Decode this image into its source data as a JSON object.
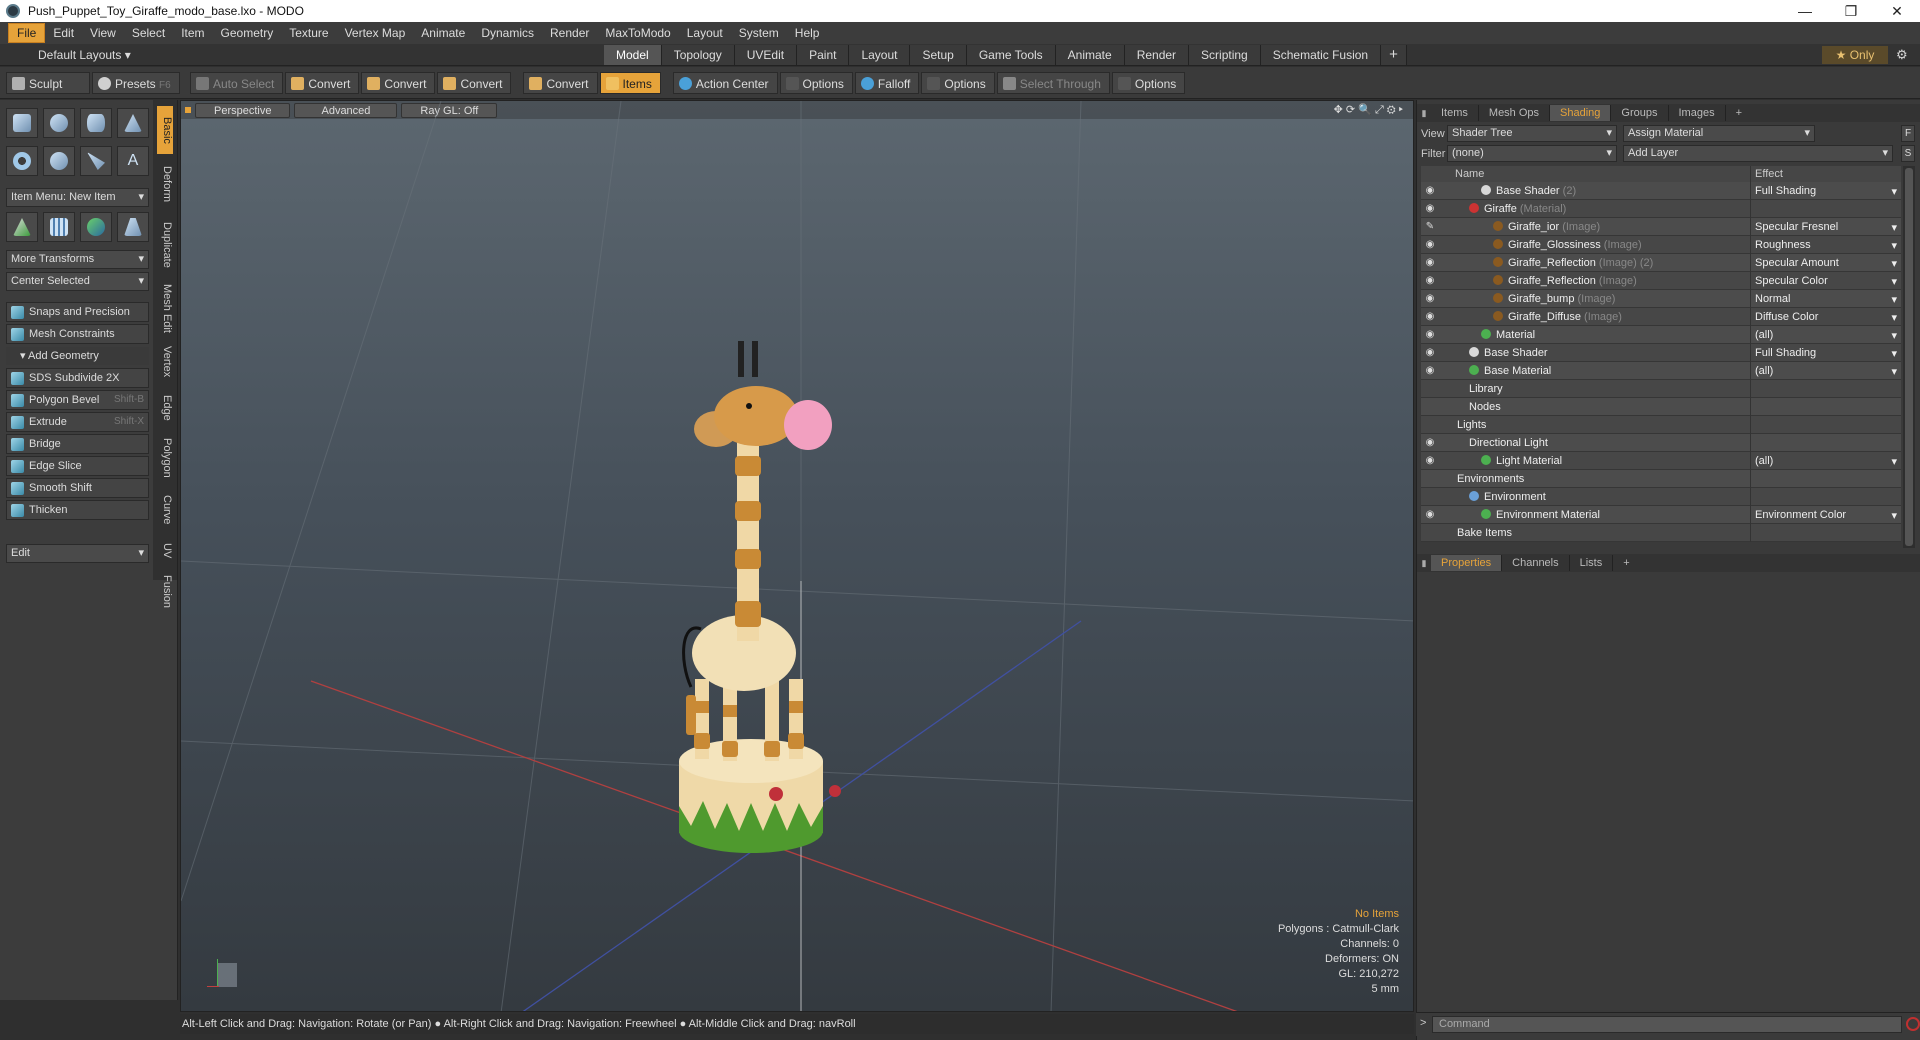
{
  "window": {
    "title": "Push_Puppet_Toy_Giraffe_modo_base.lxo - MODO",
    "minimize": "—",
    "restore": "❐",
    "close": "✕"
  },
  "menu": [
    "File",
    "Edit",
    "View",
    "Select",
    "Item",
    "Geometry",
    "Texture",
    "Vertex Map",
    "Animate",
    "Dynamics",
    "Render",
    "MaxToModo",
    "Layout",
    "System",
    "Help"
  ],
  "layouts": {
    "label": "Default Layouts ▾",
    "tabs": [
      "Model",
      "Topology",
      "UVEdit",
      "Paint",
      "Layout",
      "Setup",
      "Game Tools",
      "Animate",
      "Render",
      "Scripting",
      "Schematic Fusion"
    ],
    "active": "Model",
    "plus": "+",
    "only": "★ Only",
    "gear": "⚙"
  },
  "toolbar": {
    "sculpt": "Sculpt",
    "presets": "Presets",
    "presets_key": "F6",
    "buttons": [
      {
        "label": "Auto Select",
        "dim": true
      },
      {
        "label": "Convert"
      },
      {
        "label": "Convert"
      },
      {
        "label": "Convert"
      },
      {
        "label": "Convert"
      },
      {
        "label": "Items",
        "active": true
      },
      {
        "label": "Action Center"
      },
      {
        "label": "Options"
      },
      {
        "label": "Falloff"
      },
      {
        "label": "Options"
      },
      {
        "label": "Select Through",
        "dim": true
      },
      {
        "label": "Options"
      }
    ]
  },
  "left": {
    "vtabs": [
      "Basic",
      "Deform",
      "Duplicate",
      "Mesh Edit",
      "Vertex",
      "Edge",
      "Polygon",
      "Curve",
      "UV",
      "Fusion"
    ],
    "item_menu": "Item Menu: New Item",
    "more_transforms": "More Transforms",
    "center_selected": "Center Selected",
    "snaps": "Snaps and Precision",
    "mesh_constraints": "Mesh Constraints",
    "add_geometry": "Add Geometry",
    "tools": [
      {
        "label": "SDS Subdivide 2X",
        "key": ""
      },
      {
        "label": "Polygon Bevel",
        "key": "Shift-B"
      },
      {
        "label": "Extrude",
        "key": "Shift-X"
      },
      {
        "label": "Bridge",
        "key": ""
      },
      {
        "label": "Edge Slice",
        "key": ""
      },
      {
        "label": "Smooth Shift",
        "key": ""
      },
      {
        "label": "Thicken",
        "key": ""
      }
    ],
    "edit": "Edit"
  },
  "viewport": {
    "buttons": [
      "Perspective",
      "Advanced",
      "Ray GL: Off"
    ],
    "icons": "✥ ⟳ 🔍 ⤢ ⚙ ▸",
    "stats": {
      "items": "No Items",
      "polygons": "Polygons : Catmull-Clark",
      "channels": "Channels: 0",
      "deformers": "Deformers: ON",
      "gl": "GL: 210,272",
      "unit": "5 mm"
    }
  },
  "status": "Alt-Left Click and Drag: Navigation: Rotate (or Pan) ● Alt-Right Click and Drag: Navigation: Freewheel ● Alt-Middle Click and Drag: navRoll",
  "right": {
    "tabs": [
      "Items",
      "Mesh Ops",
      "Shading",
      "Groups",
      "Images"
    ],
    "active": "Shading",
    "view_label": "View",
    "view_value": "Shader Tree",
    "assign": "Assign Material",
    "f_btn": "F",
    "filter_label": "Filter",
    "filter_value": "(none)",
    "add_layer": "Add Layer",
    "s_btn": "S",
    "col_name": "Name",
    "col_effect": "Effect",
    "rows": [
      {
        "indent": 3,
        "name": "Base Shader",
        "sub": " (2)",
        "effect": "Full Shading",
        "eye": "◉",
        "dot": "#d8d8d8",
        "dd": true
      },
      {
        "indent": 2,
        "name": "Giraffe",
        "sub": " (Material)",
        "effect": "",
        "eye": "◉",
        "dot": "#cc3333",
        "dd": false
      },
      {
        "indent": 4,
        "name": "Giraffe_ior",
        "sub": " (Image)",
        "effect": "Specular Fresnel",
        "eye": "✎",
        "dot": "#8a5a20",
        "dd": true
      },
      {
        "indent": 4,
        "name": "Giraffe_Glossiness",
        "sub": " (Image)",
        "effect": "Roughness",
        "eye": "◉",
        "dot": "#8a5a20",
        "dd": true
      },
      {
        "indent": 4,
        "name": "Giraffe_Reflection",
        "sub": " (Image) (2)",
        "effect": "Specular Amount",
        "eye": "◉",
        "dot": "#8a5a20",
        "dd": true
      },
      {
        "indent": 4,
        "name": "Giraffe_Reflection",
        "sub": " (Image)",
        "effect": "Specular Color",
        "eye": "◉",
        "dot": "#8a5a20",
        "dd": true
      },
      {
        "indent": 4,
        "name": "Giraffe_bump",
        "sub": " (Image)",
        "effect": "Normal",
        "eye": "◉",
        "dot": "#8a5a20",
        "dd": true
      },
      {
        "indent": 4,
        "name": "Giraffe_Diffuse",
        "sub": " (Image)",
        "effect": "Diffuse Color",
        "eye": "◉",
        "dot": "#8a5a20",
        "dd": true
      },
      {
        "indent": 3,
        "name": "Material",
        "sub": "",
        "effect": "(all)",
        "eye": "◉",
        "dot": "#4caf50",
        "dd": true
      },
      {
        "indent": 2,
        "name": "Base Shader",
        "sub": "",
        "effect": "Full Shading",
        "eye": "◉",
        "dot": "#d8d8d8",
        "dd": true
      },
      {
        "indent": 2,
        "name": "Base Material",
        "sub": "",
        "effect": "(all)",
        "eye": "◉",
        "dot": "#4caf50",
        "dd": true
      },
      {
        "indent": 2,
        "name": "Library",
        "sub": "",
        "effect": "",
        "eye": "",
        "dot": "",
        "dd": false
      },
      {
        "indent": 2,
        "name": "Nodes",
        "sub": "",
        "effect": "",
        "eye": "",
        "dot": "",
        "dd": false
      },
      {
        "indent": 1,
        "name": "Lights",
        "sub": "",
        "effect": "",
        "eye": "",
        "dot": "",
        "dd": false
      },
      {
        "indent": 2,
        "name": "Directional Light",
        "sub": "",
        "effect": "",
        "eye": "◉",
        "dot": "",
        "dd": false
      },
      {
        "indent": 3,
        "name": "Light Material",
        "sub": "",
        "effect": "(all)",
        "eye": "◉",
        "dot": "#4caf50",
        "dd": true
      },
      {
        "indent": 1,
        "name": "Environments",
        "sub": "",
        "effect": "",
        "eye": "",
        "dot": "",
        "dd": false
      },
      {
        "indent": 2,
        "name": "Environment",
        "sub": "",
        "effect": "",
        "eye": "",
        "dot": "#6aa0d8",
        "dd": false
      },
      {
        "indent": 3,
        "name": "Environment Material",
        "sub": "",
        "effect": "Environment Color",
        "eye": "◉",
        "dot": "#4caf50",
        "dd": true
      },
      {
        "indent": 1,
        "name": "Bake Items",
        "sub": "",
        "effect": "",
        "eye": "",
        "dot": "",
        "dd": false
      }
    ],
    "prop_tabs": [
      "Properties",
      "Channels",
      "Lists"
    ],
    "prop_active": "Properties",
    "command_placeholder": "Command",
    "arrow": ">"
  }
}
